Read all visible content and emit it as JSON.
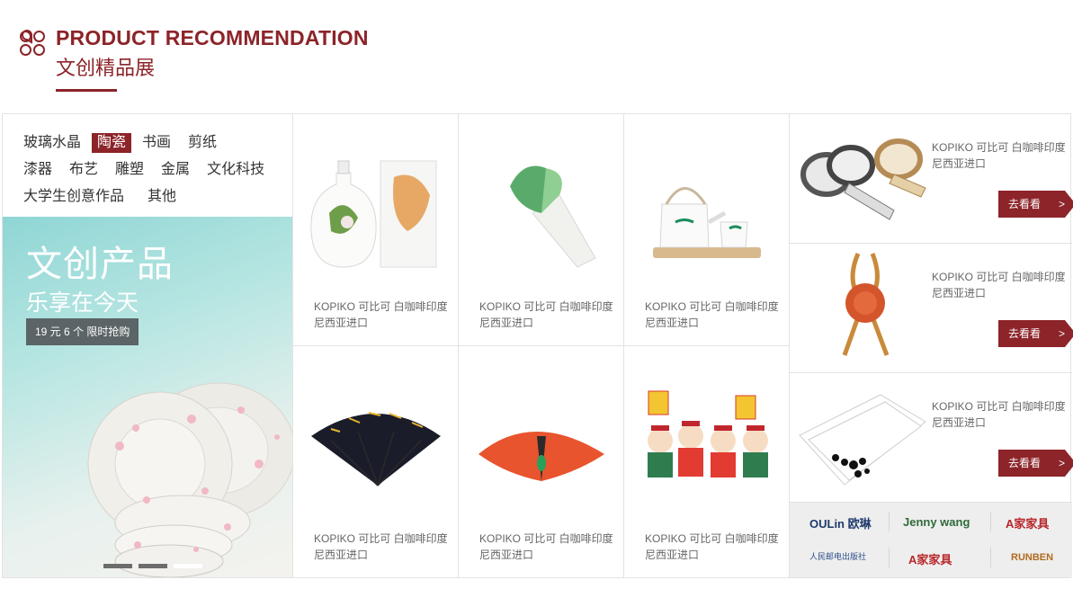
{
  "header": {
    "title_en": "PRODUCT RECOMMENDATION",
    "title_cn": "文创精品展",
    "accent_color": "#8c2429",
    "icon": "clover-icon"
  },
  "categories": {
    "rows": [
      [
        "玻璃水晶",
        "陶瓷",
        "书画",
        "剪纸"
      ],
      [
        "漆器",
        "布艺",
        "雕塑",
        "金属",
        "文化科技"
      ],
      [
        "大学生创意作品",
        "其他"
      ]
    ],
    "active": "陶瓷"
  },
  "banner": {
    "title": "文创产品",
    "subtitle": "乐享在今天",
    "tag": "19 元 6 个   限时抢购",
    "slides": 3,
    "active_slide": 3
  },
  "products": [
    {
      "caption": "KOPIKO 可比可 白咖啡印度尼西亚进口",
      "icon": "porcelain-bottle-icon"
    },
    {
      "caption": "KOPIKO 可比可 白咖啡印度尼西亚进口",
      "icon": "bamboo-shoot-sculpture-icon"
    },
    {
      "caption": "KOPIKO 可比可 白咖啡印度尼西亚进口",
      "icon": "tea-set-icon"
    },
    {
      "caption": "KOPIKO 可比可 白咖啡印度尼西亚进口",
      "icon": "folding-fan-icon"
    },
    {
      "caption": "KOPIKO 可比可 白咖啡印度尼西亚进口",
      "icon": "red-umbrella-icon"
    },
    {
      "caption": "KOPIKO 可比可 白咖啡印度尼西亚进口",
      "icon": "cartoon-figures-icon"
    }
  ],
  "side_products": [
    {
      "caption": "KOPIKO 可比可 白咖啡印度尼西亚进口",
      "button": "去看看",
      "arrow": ">",
      "icon": "washi-tape-icon"
    },
    {
      "caption": "KOPIKO 可比可 白咖啡印度尼西亚进口",
      "button": "去看看",
      "arrow": ">",
      "icon": "wax-seal-ribbon-icon"
    },
    {
      "caption": "KOPIKO 可比可 白咖啡印度尼西亚进口",
      "button": "去看看",
      "arrow": ">",
      "icon": "bookmarks-icon"
    }
  ],
  "brands": [
    {
      "name": "OULin 欧琳"
    },
    {
      "name": "Jenny wang"
    },
    {
      "name": "A家家具"
    },
    {
      "name": "人民邮电出版社"
    },
    {
      "name": "A家家具"
    },
    {
      "name": "RUNBEN"
    }
  ]
}
